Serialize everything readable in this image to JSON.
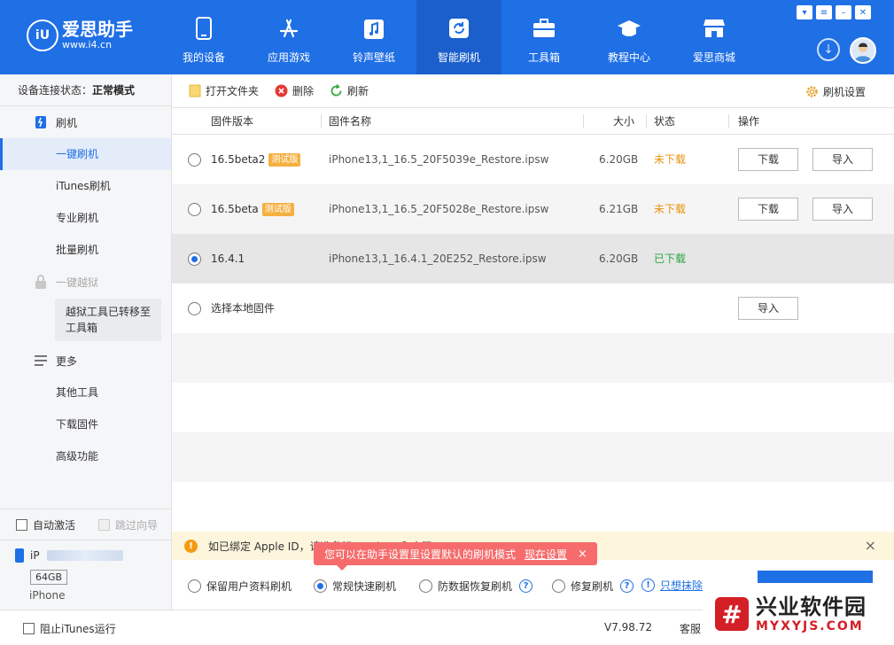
{
  "header": {
    "logo_badge": "iU",
    "logo_name": "爱思助手",
    "logo_url": "www.i4.cn",
    "nav": [
      {
        "label": "我的设备",
        "icon": "phone-icon"
      },
      {
        "label": "应用游戏",
        "icon": "app-store-icon"
      },
      {
        "label": "铃声壁纸",
        "icon": "music-icon"
      },
      {
        "label": "智能刷机",
        "icon": "refresh-icon"
      },
      {
        "label": "工具箱",
        "icon": "toolbox-icon"
      },
      {
        "label": "教程中心",
        "icon": "graduation-cap-icon"
      },
      {
        "label": "爱思商城",
        "icon": "shop-icon"
      }
    ],
    "active_nav": "智能刷机"
  },
  "sidebar": {
    "status_label": "设备连接状态：",
    "status_value": "正常模式",
    "flash_group": "刷机",
    "items": [
      "一键刷机",
      "iTunes刷机",
      "专业刷机",
      "批量刷机"
    ],
    "jailbreak_group": "一键越狱",
    "jailbreak_note": "越狱工具已转移至工具箱",
    "more_group": "更多",
    "more_items": [
      "其他工具",
      "下载固件",
      "高级功能"
    ],
    "auto_activate": "自动激活",
    "skip_guide": "跳过向导",
    "device_name": "iP",
    "device_capacity": "64GB",
    "device_model": "iPhone"
  },
  "toolbar": {
    "open_folder": "打开文件夹",
    "delete": "删除",
    "refresh": "刷新",
    "settings": "刷机设置"
  },
  "table": {
    "headers": {
      "version": "固件版本",
      "name": "固件名称",
      "size": "大小",
      "status": "状态",
      "action": "操作"
    },
    "rows": [
      {
        "version": "16.5beta2",
        "badge": "测试版",
        "name": "iPhone13,1_16.5_20F5039e_Restore.ipsw",
        "size": "6.20GB",
        "status": "未下载",
        "download": "下载",
        "import": "导入",
        "checked": false
      },
      {
        "version": "16.5beta",
        "badge": "测试版",
        "name": "iPhone13,1_16.5_20F5028e_Restore.ipsw",
        "size": "6.21GB",
        "status": "未下载",
        "download": "下载",
        "import": "导入",
        "checked": false
      },
      {
        "version": "16.4.1",
        "badge": "",
        "name": "iPhone13,1_16.4.1_20E252_Restore.ipsw",
        "size": "6.20GB",
        "status": "已下载",
        "download": "",
        "import": "",
        "checked": true
      },
      {
        "version": "选择本地固件",
        "badge": "",
        "name": "",
        "size": "",
        "status": "",
        "download": "",
        "import": "导入",
        "checked": false
      }
    ]
  },
  "notice": {
    "text": "如已绑定 Apple ID，请准备好 Apple ID和密码",
    "close": "×"
  },
  "tooltip": {
    "text": "您可以在助手设置里设置默认的刷机模式",
    "link": "现在设置",
    "close": "×"
  },
  "modes": {
    "keep_data": "保留用户资料刷机",
    "quick": "常规快速刷机",
    "anti_recovery": "防数据恢复刷机",
    "repair": "修复刷机",
    "wipe_link": "只想抹除",
    "selected": "常规快速刷机"
  },
  "status_bar": {
    "stop_itunes": "阻止iTunes运行",
    "version": "V7.98.72",
    "service": "客服"
  },
  "watermark": {
    "cn": "兴业软件园",
    "en": "MYXYJS.COM"
  },
  "colors": {
    "brand_blue": "#1f6fe5",
    "warning_orange": "#e8920d",
    "success_green": "#2aa640",
    "tooltip_red": "#f66c6c"
  }
}
